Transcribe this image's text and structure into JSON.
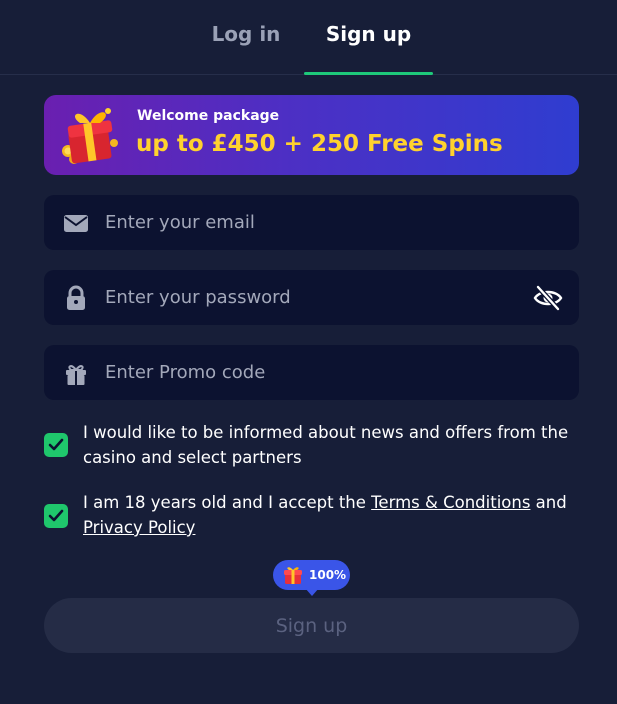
{
  "tabs": {
    "login": "Log in",
    "signup": "Sign up",
    "active": "signup"
  },
  "banner": {
    "subtitle": "Welcome package",
    "offer": "up to £450 + 250 Free Spins",
    "icon": "gift-box-icon"
  },
  "form": {
    "email": {
      "placeholder": "Enter your email",
      "value": "",
      "icon": "envelope-icon"
    },
    "password": {
      "placeholder": "Enter your password",
      "value": "",
      "icon": "lock-icon",
      "toggle_icon": "eye-slash-icon"
    },
    "promo": {
      "placeholder": "Enter Promo code",
      "value": "",
      "icon": "gift-icon"
    }
  },
  "consents": {
    "news": {
      "checked": true,
      "text": "I would like to be informed about news and offers from the casino and select partners"
    },
    "age": {
      "checked": true,
      "text_before": "I am 18 years old and I accept the ",
      "terms_link": "Terms & Conditions",
      "text_middle": " and ",
      "privacy_link": "Privacy Policy"
    }
  },
  "badge": {
    "text": "100%",
    "icon": "gift-icon"
  },
  "submit": {
    "label": "Sign up",
    "enabled": false
  },
  "colors": {
    "background": "#171e38",
    "field": "#0c1230",
    "accent_green": "#1ec97a",
    "offer_yellow": "#ffd22e",
    "badge_blue": "#3a55e8",
    "button_disabled": "#252c46"
  }
}
